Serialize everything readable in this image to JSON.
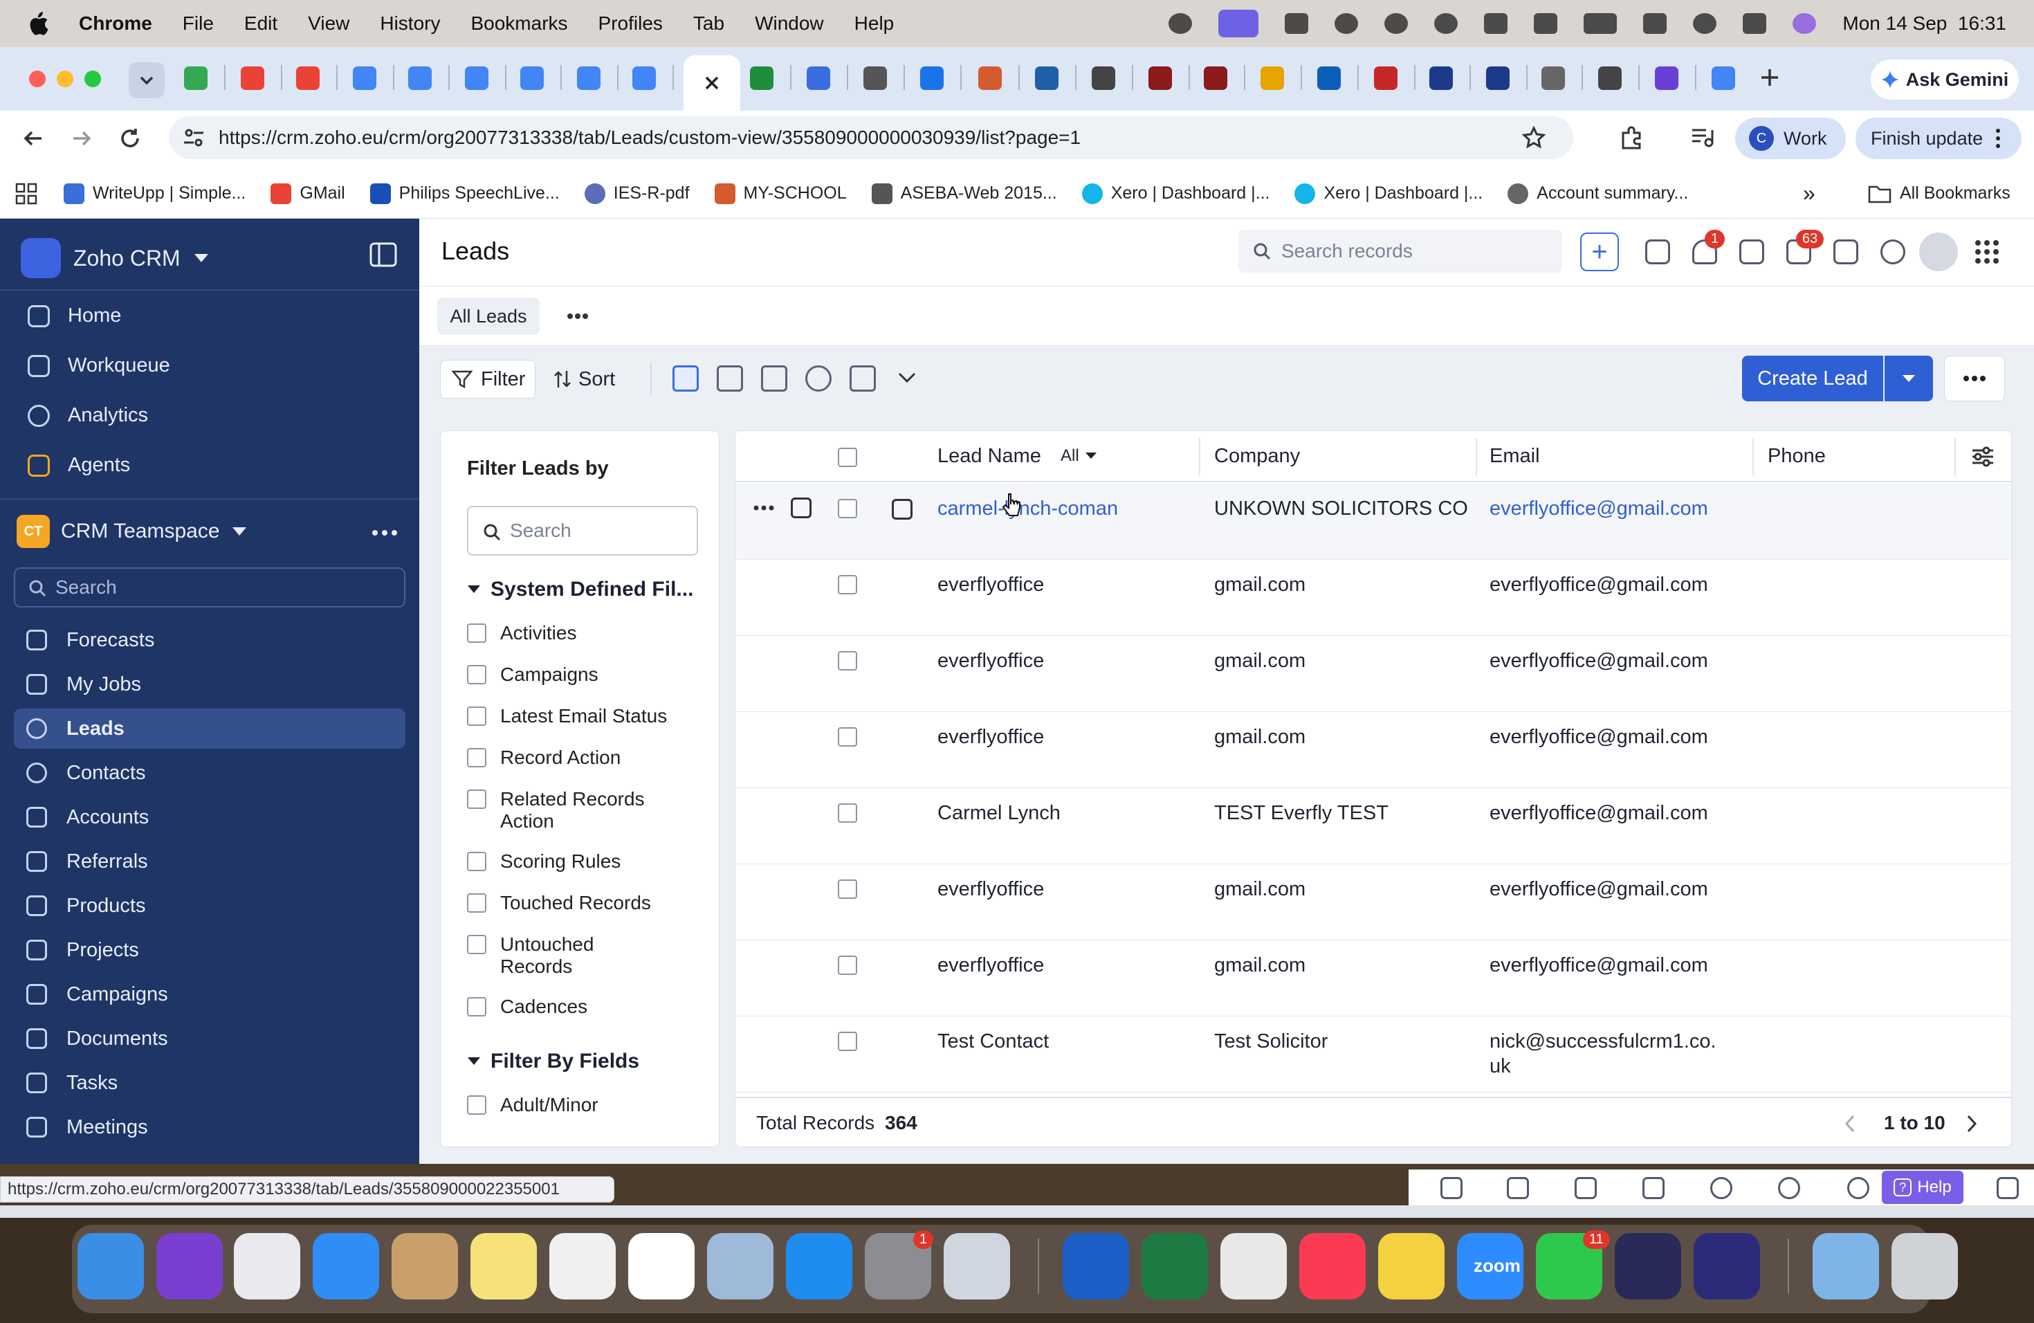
{
  "menubar": {
    "app": "Chrome",
    "items": [
      "File",
      "Edit",
      "View",
      "History",
      "Bookmarks",
      "Profiles",
      "Tab",
      "Window",
      "Help"
    ],
    "clock": "Mon 14 Sep  16:31"
  },
  "browser": {
    "ask_gemini": "Ask Gemini",
    "url": "https://crm.zoho.eu/crm/org20077313338/tab/Leads/custom-view/355809000000030939/list?page=1",
    "profile_initial": "C",
    "profile_label": "Work",
    "finish_update": "Finish update",
    "bookmarks": [
      "WriteUpp | Simple...",
      "GMail",
      "Philips SpeechLive...",
      "IES-R-pdf",
      "MY-SCHOOL",
      "ASEBA-Web 2015...",
      "Xero | Dashboard |...",
      "Xero | Dashboard |...",
      "Account summary..."
    ],
    "all_bookmarks": "All Bookmarks",
    "status_url": "https://crm.zoho.eu/crm/org20077313338/tab/Leads/355809000022355001"
  },
  "sidebar": {
    "brand": "Zoho CRM",
    "nav": [
      "Home",
      "Workqueue",
      "Analytics",
      "Agents"
    ],
    "team_badge": "CT",
    "team": "CRM Teamspace",
    "search_placeholder": "Search",
    "modules": [
      "Forecasts",
      "My Jobs",
      "Leads",
      "Contacts",
      "Accounts",
      "Referrals",
      "Products",
      "Projects",
      "Campaigns",
      "Documents",
      "Tasks",
      "Meetings"
    ],
    "active_module": "Leads"
  },
  "header": {
    "title": "Leads",
    "search_placeholder": "Search records",
    "notifications_count": "1",
    "mail_count": "63"
  },
  "view": {
    "tab": "All Leads",
    "filter_label": "Filter",
    "sort_label": "Sort",
    "create_label": "Create Lead"
  },
  "filter_panel": {
    "title": "Filter Leads by",
    "search_placeholder": "Search",
    "system_group": "System Defined Fil...",
    "system_items": [
      "Activities",
      "Campaigns",
      "Latest Email Status",
      "Record Action",
      "Related Records Action",
      "Scoring Rules",
      "Touched Records",
      "Untouched Records",
      "Cadences"
    ],
    "fields_group": "Filter By Fields",
    "field_items": [
      "Adult/Minor"
    ]
  },
  "table": {
    "columns": {
      "lead_name": "Lead Name",
      "lead_filter": "All",
      "company": "Company",
      "email": "Email",
      "phone": "Phone"
    },
    "rows": [
      {
        "name": "carmel-lynch-coman",
        "company": "UNKOWN SOLICITORS CO",
        "email": "everflyoffice@gmail.com",
        "phone": ""
      },
      {
        "name": "everflyoffice",
        "company": "gmail.com",
        "email": "everflyoffice@gmail.com",
        "phone": ""
      },
      {
        "name": "everflyoffice",
        "company": "gmail.com",
        "email": "everflyoffice@gmail.com",
        "phone": ""
      },
      {
        "name": "everflyoffice",
        "company": "gmail.com",
        "email": "everflyoffice@gmail.com",
        "phone": ""
      },
      {
        "name": "Carmel Lynch",
        "company": "TEST Everfly TEST",
        "email": "everflyoffice@gmail.com",
        "phone": ""
      },
      {
        "name": "everflyoffice",
        "company": "gmail.com",
        "email": "everflyoffice@gmail.com",
        "phone": ""
      },
      {
        "name": "everflyoffice",
        "company": "gmail.com",
        "email": "everflyoffice@gmail.com",
        "phone": ""
      },
      {
        "name": "Test Contact",
        "company": "Test Solicitor",
        "email": "nick@successfulcrm1.co.uk",
        "phone": ""
      }
    ],
    "total_label": "Total Records",
    "total": "364",
    "page_range": "1 to 10"
  },
  "bottom_bar": {
    "help": "Help"
  },
  "dock": {
    "settings_badge": "1",
    "facetime_badge": "11",
    "zoom_label": "zoom"
  },
  "colors": {
    "sidebar": "#1f3566",
    "accent": "#2f5fd4",
    "active_nav": "#34508d",
    "badge": "#e0352b"
  }
}
